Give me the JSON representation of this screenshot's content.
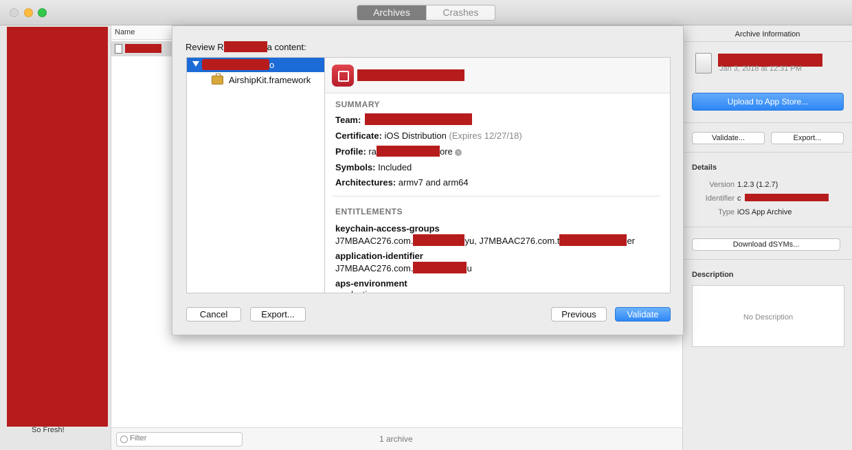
{
  "toolbar": {
    "tab_archives": "Archives",
    "tab_crashes": "Crashes"
  },
  "list": {
    "column_name": "Name",
    "partial_text": "So Fresh!",
    "filter_placeholder": "Filter",
    "count": "1 archive"
  },
  "sheet": {
    "title_start": "Review R",
    "title_end": "a content:",
    "tree_selected_suffix": "o",
    "tree_child": "AirshipKit.framework",
    "summary": {
      "header": "SUMMARY",
      "team_label": "Team:",
      "certificate_label": "Certificate:",
      "certificate_value": "iOS Distribution",
      "certificate_expires": "(Expires 12/27/18)",
      "profile_label": "Profile:",
      "profile_prefix": "ra",
      "profile_suffix": "ore",
      "symbols_label": "Symbols:",
      "symbols_value": "Included",
      "arch_label": "Architectures:",
      "arch_value": "armv7 and arm64"
    },
    "entitlements": {
      "header": "ENTITLEMENTS",
      "items": [
        {
          "key": "keychain-access-groups",
          "value_a": "J7MBAAC276.com.",
          "value_b": "yu, J7MBAAC276.com.t",
          "value_c": "er"
        },
        {
          "key": "application-identifier",
          "value_a": "J7MBAAC276.com.",
          "value_b": "u"
        },
        {
          "key": "aps-environment",
          "value_a": "production"
        }
      ]
    },
    "buttons": {
      "cancel": "Cancel",
      "export": "Export...",
      "previous": "Previous",
      "validate": "Validate"
    }
  },
  "archive_info": {
    "title": "Archive Information",
    "date": "Jan 3, 2018 at 12:31 PM",
    "upload": "Upload to App Store...",
    "validate": "Validate...",
    "export": "Export...",
    "details_title": "Details",
    "version_label": "Version",
    "version_value": "1.2.3 (1.2.7)",
    "identifier_label": "Identifier",
    "identifier_value": "c",
    "type_label": "Type",
    "type_value": "iOS App Archive",
    "download_dsyms": "Download dSYMs...",
    "description_title": "Description",
    "description_placeholder": "No Description"
  },
  "colors": {
    "redaction": "#b71c1c",
    "accent": "#2f87f5",
    "selection": "#1c6bd6"
  }
}
